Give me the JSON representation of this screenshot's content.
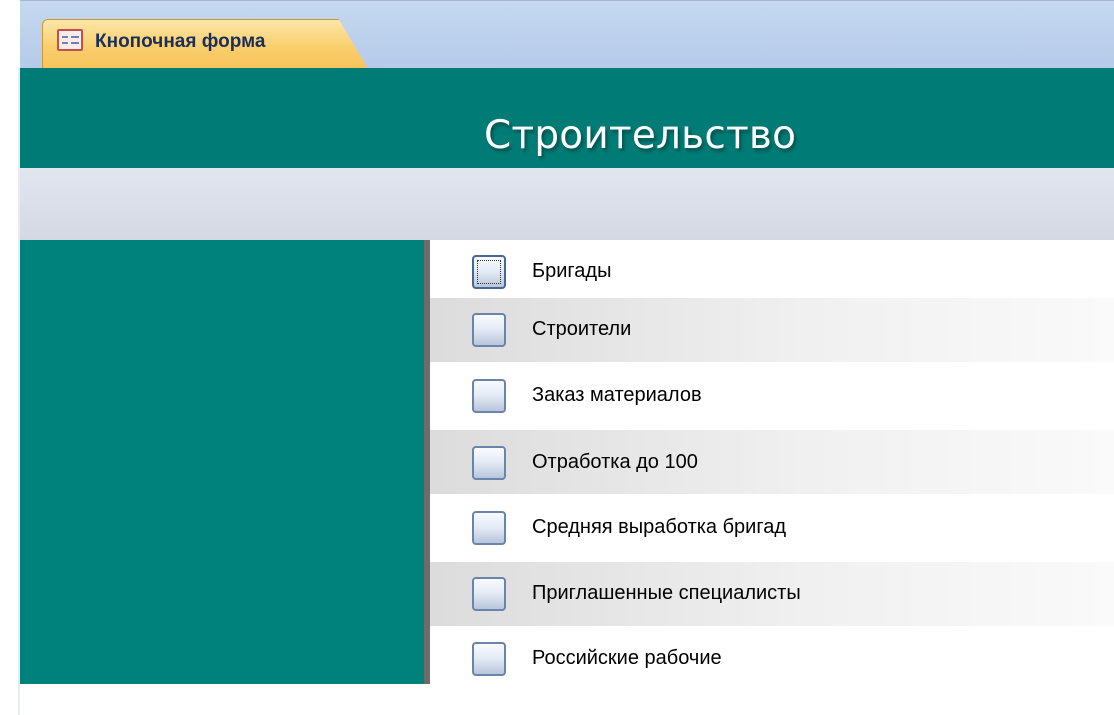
{
  "tab": {
    "label": "Кнопочная форма",
    "icon": "form-icon"
  },
  "header": {
    "title": "Строительство"
  },
  "colors": {
    "accent": "#007b75",
    "panel": "#00827c",
    "tab": "#f9cf6d"
  },
  "menu": {
    "items": [
      {
        "label": "Бригады"
      },
      {
        "label": "Строители"
      },
      {
        "label": "Заказ материалов"
      },
      {
        "label": "Отработка до 100"
      },
      {
        "label": "Средняя выработка бригад"
      },
      {
        "label": "Приглашенные специалисты"
      },
      {
        "label": "Российские рабочие"
      }
    ]
  }
}
